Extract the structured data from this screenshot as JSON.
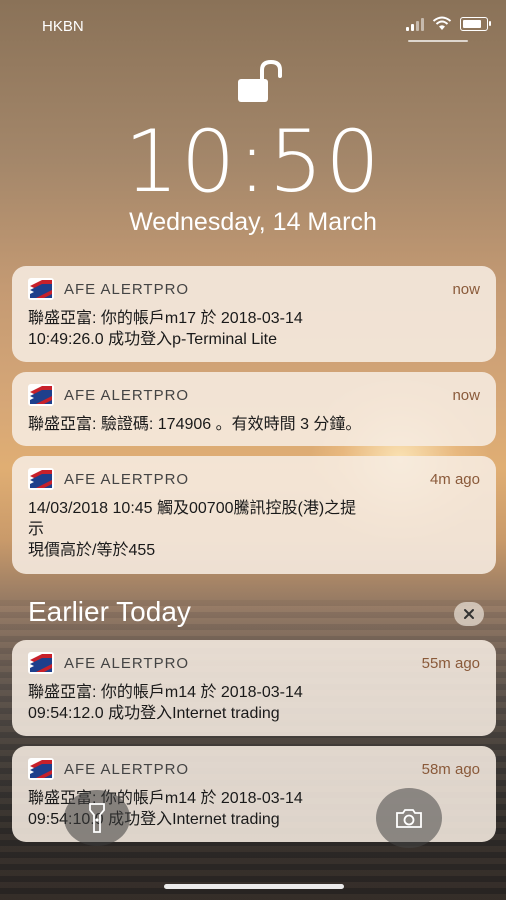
{
  "status_bar": {
    "carrier": "HKBN",
    "icons": [
      "signal-icon",
      "wifi-icon",
      "battery-icon"
    ]
  },
  "lock_screen": {
    "time": "10:50",
    "date": "Wednesday, 14 March",
    "lock_icon": "unlocked-padlock-icon"
  },
  "notifications": [
    {
      "app": "AFE ALERTPRO",
      "when": "now",
      "body": "聯盛亞富: 你的帳戶m17 於 2018-03-14\n10:49:26.0 成功登入p-Terminal Lite"
    },
    {
      "app": "AFE ALERTPRO",
      "when": "now",
      "body": "聯盛亞富: 驗證碼: 174906 。有效時間 3 分鐘。"
    },
    {
      "app": "AFE ALERTPRO",
      "when": "4m ago",
      "body": "14/03/2018 10:45 觸及00700騰訊控股(港)之提\n示\n現價高於/等於455"
    }
  ],
  "earlier": {
    "title": "Earlier Today",
    "clear_icon": "close-icon",
    "notifications": [
      {
        "app": "AFE ALERTPRO",
        "when": "55m ago",
        "body": "聯盛亞富: 你的帳戶m14 於 2018-03-14\n09:54:12.0 成功登入Internet trading"
      },
      {
        "app": "AFE ALERTPRO",
        "when": "58m ago",
        "body": "聯盛亞富: 你的帳戶m14 於 2018-03-14\n09:54:10.0 成功登入Internet trading"
      }
    ]
  },
  "quick_actions": {
    "flashlight_icon": "flashlight-icon",
    "camera_icon": "camera-icon"
  },
  "colors": {
    "accent_time": "#8a5a3a",
    "card_bg": "#f6ece1"
  }
}
